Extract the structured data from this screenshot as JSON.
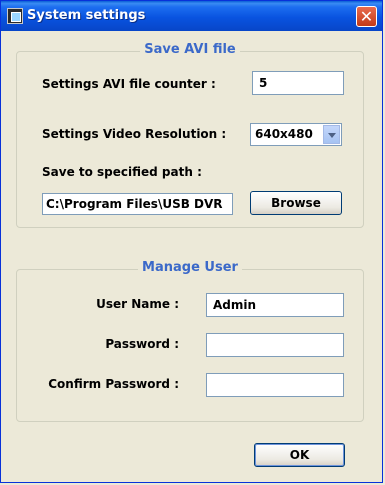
{
  "window": {
    "title": "System settings",
    "close_glyph": "✕"
  },
  "save_avi": {
    "legend": "Save AVI file",
    "counter_label": "Settings AVI file counter :",
    "counter_value": "5",
    "resolution_label": "Settings Video Resolution :",
    "resolution_value": "640x480",
    "path_label": "Save to specified path :",
    "path_value": "C:\\Program Files\\USB DVR",
    "browse_label": "Browse"
  },
  "manage_user": {
    "legend": "Manage User",
    "username_label": "User Name :",
    "username_value": "Admin",
    "password_label": "Password :",
    "password_value": "",
    "confirm_label": "Confirm Password :",
    "confirm_value": ""
  },
  "footer": {
    "ok_label": "OK"
  },
  "colors": {
    "accent": "#3b69c9",
    "titlebar": "#0953e0",
    "dialog_bg": "#ece9d8"
  },
  "icons": {
    "app": "app-window-icon",
    "close": "close-icon",
    "dropdown": "chevron-down-icon"
  }
}
